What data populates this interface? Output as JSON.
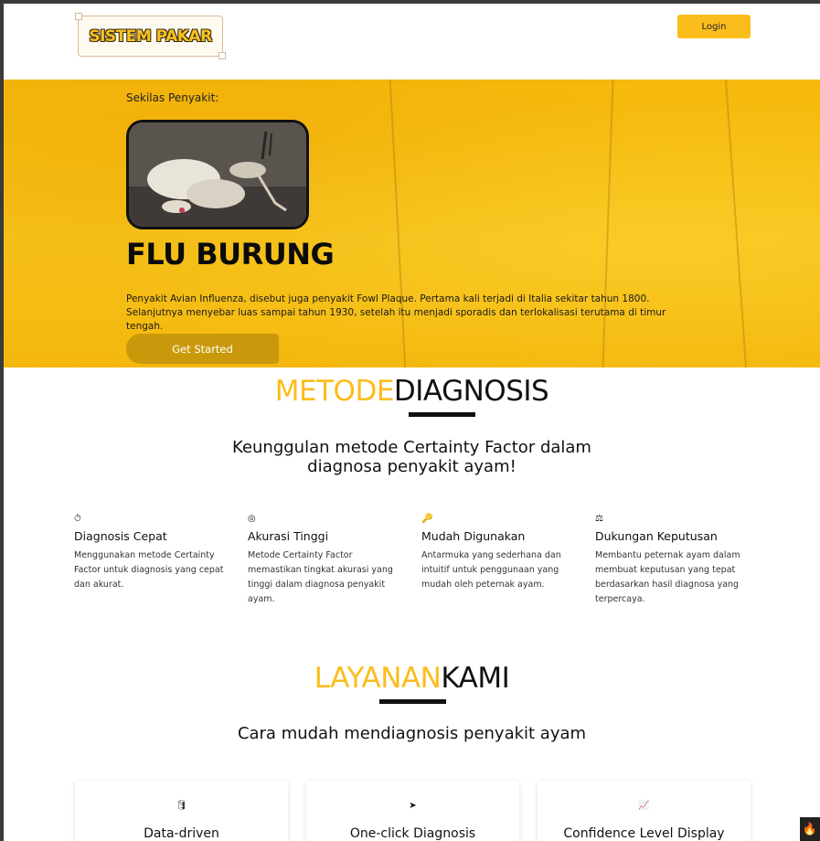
{
  "nav": {
    "logo_text": "SISTEM PAKAR",
    "login_label": "Login"
  },
  "hero": {
    "kicker": "Sekilas Penyakit:",
    "title": "FLU BURUNG",
    "description": "Penyakit Avian Influenza, disebut juga penyakit Fowl Plaque. Pertama kali terjadi di Italia sekitar tahun 1800. Selanjutnya menyebar luas sampai tahun 1930, setelah itu menjadi sporadis dan terlokalisasi terutama di timur tengah.",
    "cta_label": "Get Started",
    "photo_alt": "chicken-photo"
  },
  "metode": {
    "title_highlight": "METODE",
    "title_rest": "DIAGNOSIS",
    "subtitle_line1": "Keunggulan metode Certainty Factor dalam",
    "subtitle_line2": "diagnosa penyakit ayam!",
    "features": [
      {
        "icon": "stopwatch-icon",
        "glyph": "⏱",
        "title": "Diagnosis Cepat",
        "desc": "Menggunakan metode Certainty Factor untuk diagnosis yang cepat dan akurat."
      },
      {
        "icon": "target-icon",
        "glyph": "◎",
        "title": "Akurasi Tinggi",
        "desc": "Metode Certainty Factor memastikan tingkat akurasi yang tinggi dalam diagnosa penyakit ayam."
      },
      {
        "icon": "key-icon",
        "glyph": "🔑",
        "title": "Mudah Digunakan",
        "desc": "Antarmuka yang sederhana dan intuitif untuk penggunaan yang mudah oleh peternak ayam."
      },
      {
        "icon": "scale-icon",
        "glyph": "⚖",
        "title": "Dukungan Keputusan",
        "desc": "Membantu peternak ayam dalam membuat keputusan yang tepat berdasarkan hasil diagnosa yang terpercaya."
      }
    ]
  },
  "layanan": {
    "title_highlight": "LAYANAN",
    "title_rest": "KAMI",
    "subtitle": "Cara mudah mendiagnosis penyakit ayam",
    "cards": [
      {
        "icon": "database-icon",
        "glyph": "🛢",
        "title": "Data-driven"
      },
      {
        "icon": "cursor-icon",
        "glyph": "➤",
        "title": "One-click Diagnosis"
      },
      {
        "icon": "chart-icon",
        "glyph": "📈",
        "title": "Confidence Level Display"
      }
    ]
  },
  "colors": {
    "accent": "#fbbd1c",
    "hero_bg": "#f6b90c",
    "cta": "#c9990b"
  }
}
